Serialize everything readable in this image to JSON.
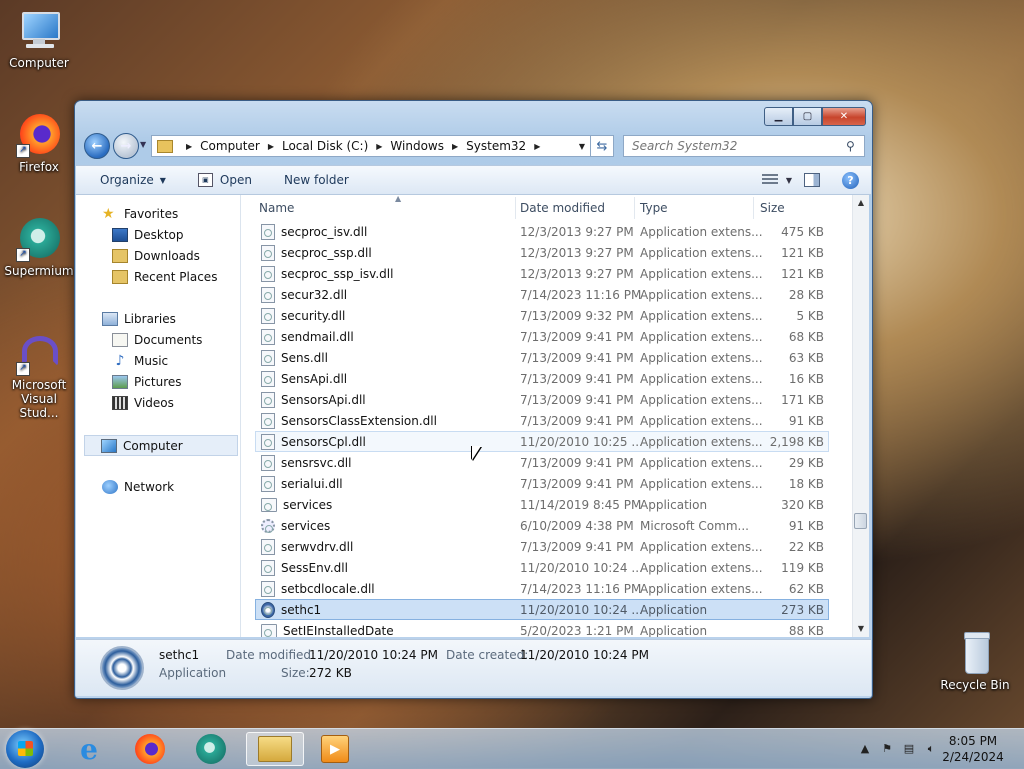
{
  "desktop": {
    "icons": [
      {
        "label": "Computer"
      },
      {
        "label": "Firefox"
      },
      {
        "label": "Supermium"
      },
      {
        "label_line1": "Microsoft",
        "label_line2": "Visual Stud..."
      },
      {
        "label": "Recycle Bin"
      }
    ]
  },
  "window": {
    "address": {
      "crumbs": [
        "Computer",
        "Local Disk (C:)",
        "Windows",
        "System32"
      ]
    },
    "search": {
      "placeholder": "Search System32"
    },
    "commands": {
      "organize": "Organize",
      "open": "Open",
      "new_folder": "New folder"
    },
    "nav": {
      "favorites": "Favorites",
      "desktop": "Desktop",
      "downloads": "Downloads",
      "recent_places": "Recent Places",
      "libraries": "Libraries",
      "documents": "Documents",
      "music": "Music",
      "pictures": "Pictures",
      "videos": "Videos",
      "computer": "Computer",
      "network": "Network"
    },
    "columns": {
      "name": "Name",
      "date": "Date modified",
      "type": "Type",
      "size": "Size"
    },
    "files": [
      {
        "name": "secproc_isv.dll",
        "date": "12/3/2013 9:27 PM",
        "type": "Application extens...",
        "size": "475 KB"
      },
      {
        "name": "secproc_ssp.dll",
        "date": "12/3/2013 9:27 PM",
        "type": "Application extens...",
        "size": "121 KB"
      },
      {
        "name": "secproc_ssp_isv.dll",
        "date": "12/3/2013 9:27 PM",
        "type": "Application extens...",
        "size": "121 KB"
      },
      {
        "name": "secur32.dll",
        "date": "7/14/2023 11:16 PM",
        "type": "Application extens...",
        "size": "28 KB"
      },
      {
        "name": "security.dll",
        "date": "7/13/2009 9:32 PM",
        "type": "Application extens...",
        "size": "5 KB"
      },
      {
        "name": "sendmail.dll",
        "date": "7/13/2009 9:41 PM",
        "type": "Application extens...",
        "size": "68 KB"
      },
      {
        "name": "Sens.dll",
        "date": "7/13/2009 9:41 PM",
        "type": "Application extens...",
        "size": "63 KB"
      },
      {
        "name": "SensApi.dll",
        "date": "7/13/2009 9:41 PM",
        "type": "Application extens...",
        "size": "16 KB"
      },
      {
        "name": "SensorsApi.dll",
        "date": "7/13/2009 9:41 PM",
        "type": "Application extens...",
        "size": "171 KB"
      },
      {
        "name": "SensorsClassExtension.dll",
        "date": "7/13/2009 9:41 PM",
        "type": "Application extens...",
        "size": "91 KB"
      },
      {
        "name": "SensorsCpl.dll",
        "date": "11/20/2010 10:25 ...",
        "type": "Application extens...",
        "size": "2,198 KB"
      },
      {
        "name": "sensrsvc.dll",
        "date": "7/13/2009 9:41 PM",
        "type": "Application extens...",
        "size": "29 KB"
      },
      {
        "name": "serialui.dll",
        "date": "7/13/2009 9:41 PM",
        "type": "Application extens...",
        "size": "18 KB"
      },
      {
        "name": "services",
        "date": "11/14/2019 8:45 PM",
        "type": "Application",
        "size": "320 KB"
      },
      {
        "name": "services",
        "date": "6/10/2009 4:38 PM",
        "type": "Microsoft Comm...",
        "size": "91 KB"
      },
      {
        "name": "serwvdrv.dll",
        "date": "7/13/2009 9:41 PM",
        "type": "Application extens...",
        "size": "22 KB"
      },
      {
        "name": "SessEnv.dll",
        "date": "11/20/2010 10:24 ...",
        "type": "Application extens...",
        "size": "119 KB"
      },
      {
        "name": "setbcdlocale.dll",
        "date": "7/14/2023 11:16 PM",
        "type": "Application extens...",
        "size": "62 KB"
      },
      {
        "name": "sethc1",
        "date": "11/20/2010 10:24 ...",
        "type": "Application",
        "size": "273 KB"
      },
      {
        "name": "SetIEInstalledDate",
        "date": "5/20/2023 1:21 PM",
        "type": "Application",
        "size": "88 KB"
      }
    ],
    "details": {
      "name": "sethc1",
      "type": "Application",
      "modified_label": "Date modified:",
      "modified_value": "11/20/2010 10:24 PM",
      "created_label": "Date created:",
      "created_value": "11/20/2010 10:24 PM",
      "size_label": "Size:",
      "size_value": "272 KB"
    }
  },
  "taskbar": {
    "time": "8:05 PM",
    "date": "2/24/2024"
  },
  "colors": {
    "selection": "#cce0f6",
    "accent": "#1e395b"
  }
}
